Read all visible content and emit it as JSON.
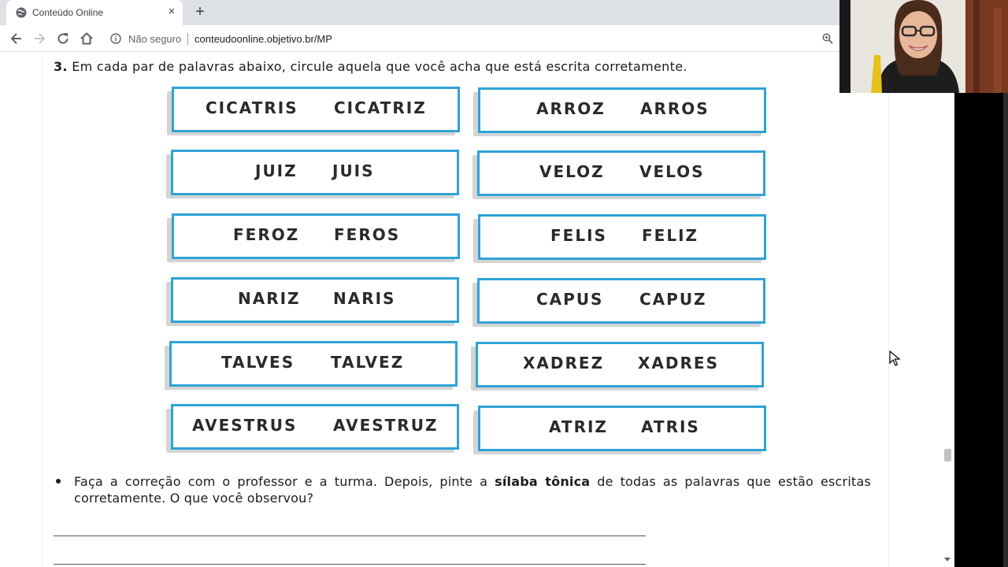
{
  "browser": {
    "tab_title": "Conteúdo Online",
    "tab_close_glyph": "×",
    "new_tab_glyph": "+",
    "security_text": "Não seguro",
    "url": "conteudoonline.objetivo.br/MP"
  },
  "exercise": {
    "number": "3.",
    "instruction": "Em cada par de palavras abaixo, circule aquela que você acha que está escrita corretamente.",
    "pairs": [
      {
        "a": "CICATRIS",
        "b": "CICATRIZ"
      },
      {
        "a": "ARROZ",
        "b": "ARROS"
      },
      {
        "a": "JUIZ",
        "b": "JUIS"
      },
      {
        "a": "VELOZ",
        "b": "VELOS"
      },
      {
        "a": "FEROZ",
        "b": "FEROS"
      },
      {
        "a": "FELIS",
        "b": "FELIZ"
      },
      {
        "a": "NARIZ",
        "b": "NARIS"
      },
      {
        "a": "CAPUS",
        "b": "CAPUZ"
      },
      {
        "a": "TALVES",
        "b": "TALVEZ"
      },
      {
        "a": "XADREZ",
        "b": "XADRES"
      },
      {
        "a": "AVESTRUS",
        "b": "AVESTRUZ"
      },
      {
        "a": "ATRIZ",
        "b": "ATRIS"
      }
    ],
    "followup_before": "Faça a correção com o professor e a turma. Depois, pinte a ",
    "followup_bold": "sílaba tônica",
    "followup_after": " de todas as palavras que estão escritas corretamente. O que você observou?"
  },
  "colors": {
    "card_border": "#2ea3d6",
    "tab_bar": "#dee1e6"
  },
  "icons": [
    "globe-icon",
    "close-icon",
    "plus-icon",
    "back-arrow-icon",
    "forward-arrow-icon",
    "reload-icon",
    "home-icon",
    "info-icon",
    "zoom-icon",
    "mouse-cursor-icon"
  ]
}
